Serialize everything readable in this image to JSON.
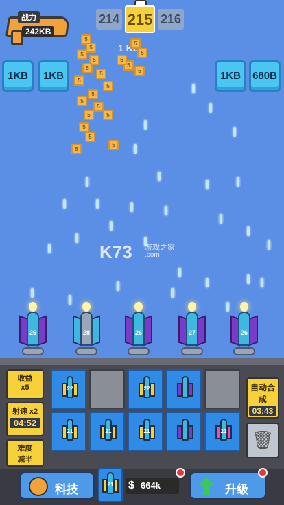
{
  "power": {
    "label": "战力",
    "value": "242KB"
  },
  "wave": {
    "prev": "214",
    "current": "215",
    "next": "216"
  },
  "drop_text": "1 KB",
  "blocks": [
    {
      "id": "b1",
      "label": "1KB"
    },
    {
      "id": "b2",
      "label": "1KB"
    },
    {
      "id": "b3",
      "label": "1KB"
    },
    {
      "id": "b4",
      "label": "680B"
    }
  ],
  "watermark": {
    "big": "K73",
    "small": "游戏之家",
    "url": ".com"
  },
  "turret_levels": [
    "26",
    "28",
    "26",
    "27",
    "26"
  ],
  "side_panel": {
    "income": {
      "title": "收益",
      "value": "x5"
    },
    "speed": {
      "title": "射速",
      "mult": "x2",
      "timer": "04:52"
    },
    "difficulty": {
      "title": "难度",
      "value": "减半"
    }
  },
  "grid": [
    {
      "lvl": "22",
      "style": "yellow"
    },
    {
      "lvl": "",
      "style": "empty"
    },
    {
      "lvl": "22",
      "style": "yellow"
    },
    {
      "lvl": "",
      "style": "purple"
    },
    {
      "lvl": "",
      "style": "empty"
    },
    {
      "lvl": "21",
      "style": "yellow"
    },
    {
      "lvl": "21",
      "style": "yellow"
    },
    {
      "lvl": "21",
      "style": "yellow"
    },
    {
      "lvl": "",
      "style": "purple"
    },
    {
      "lvl": "21",
      "style": "pink"
    }
  ],
  "auto_merge": {
    "title": "自动合成",
    "timer": "03:43"
  },
  "bottom": {
    "tech_label": "科技",
    "ship_lvl": "21",
    "coins": "664k",
    "upgrade_label": "升级"
  },
  "colors": {
    "background": "#5b8fe6",
    "accent": "#f7d13a",
    "panel": "#4a4a52"
  }
}
